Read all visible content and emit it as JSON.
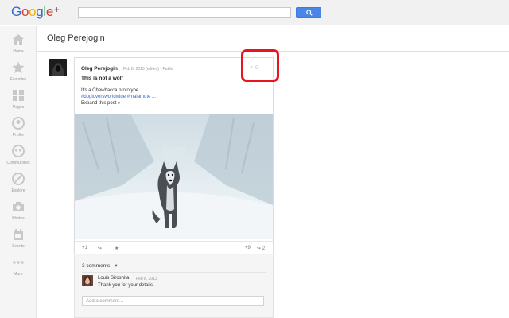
{
  "app": {
    "logo_text": "Google",
    "logo_plus": "+"
  },
  "search": {
    "placeholder": ""
  },
  "sidebar": {
    "items": [
      {
        "label": "Home",
        "icon": "home-icon"
      },
      {
        "label": "Favorites",
        "icon": "star-icon"
      },
      {
        "label": "Pages",
        "icon": "pages-icon"
      },
      {
        "label": "Profile",
        "icon": "profile-icon"
      },
      {
        "label": "Communities",
        "icon": "communities-icon"
      },
      {
        "label": "Explore",
        "icon": "explore-icon"
      },
      {
        "label": "Photos",
        "icon": "camera-icon"
      },
      {
        "label": "Events",
        "icon": "calendar-icon"
      },
      {
        "label": "More",
        "icon": "more-icon"
      }
    ]
  },
  "header": {
    "title": "Oleg Perejogin"
  },
  "post": {
    "author": "Oleg Perejogin",
    "meta": "Feb 8, 2013 (edited)  -  Public",
    "title": "This is not a wolf",
    "text": "It's a Chewbacca prototype",
    "tags": "#dogloversworldwide #malamute ...",
    "expand": "Expand this post »",
    "actions": "× ⊙",
    "footer": {
      "plus_one": "+1",
      "share": "↪",
      "star": "★",
      "plus_count": "+9",
      "share_count": "↪ 2"
    }
  },
  "comments": {
    "count_label": "3 comments",
    "chevron": "▾",
    "items": [
      {
        "author": "Louis Siroshita",
        "time": "Feb 8, 2013",
        "text": "Thank you for your details."
      }
    ],
    "input_placeholder": "Add a comment..."
  },
  "colors": {
    "accent": "#4a86e8",
    "link": "#3366cc",
    "highlight": "#e8141e"
  }
}
